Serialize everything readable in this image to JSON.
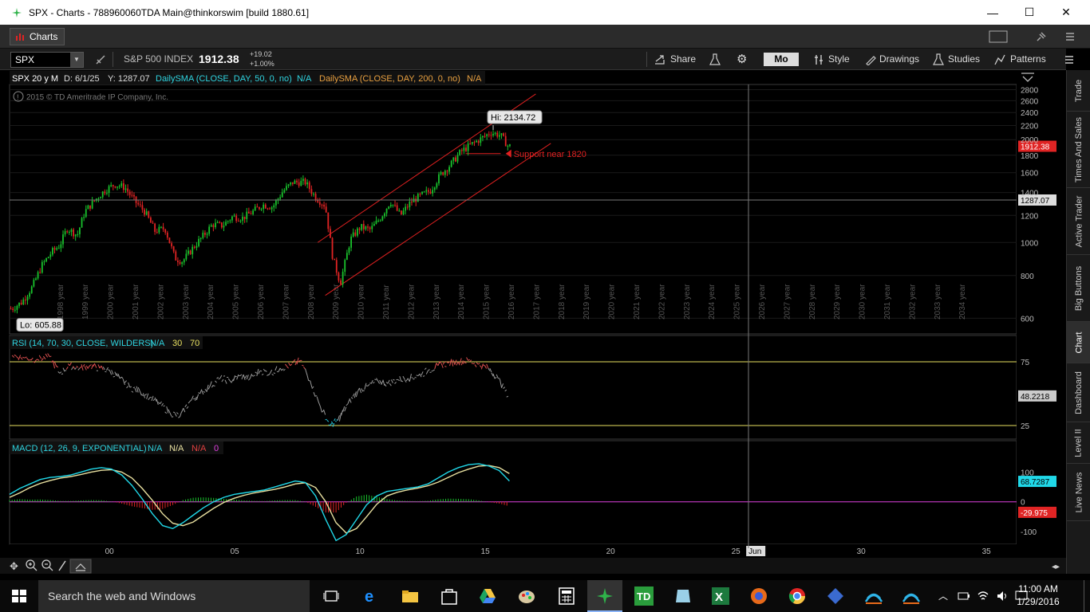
{
  "window": {
    "title": "SPX - Charts - 788960060TDA Main@thinkorswim [build 1880.61]",
    "controls": [
      "—",
      "☐",
      "✕"
    ]
  },
  "tabbar": {
    "tab_label": "Charts"
  },
  "toolbar": {
    "symbol": "SPX",
    "name": "S&P 500 INDEX",
    "price": "1912.38",
    "change": "+19.02",
    "change_pct": "+1.00%",
    "share": "Share",
    "mode": "Mo",
    "style": "Style",
    "drawings": "Drawings",
    "studies": "Studies",
    "patterns": "Patterns"
  },
  "chart_header": {
    "aggregation": "SPX 20 y M",
    "date": "D: 6/1/25",
    "y_value": "Y: 1287.07",
    "sma50": "DailySMA (CLOSE, DAY, 50, 0, no)",
    "sma50_val": "N/A",
    "sma200": "DailySMA (CLOSE, DAY, 200, 0, no)",
    "sma200_val": "N/A",
    "copyright": "2015 © TD Ameritrade IP Company, Inc."
  },
  "annotations": {
    "hi_label": "Hi: 2134.72",
    "lo_label": "Lo: 605.88",
    "support_label": "Support near 1820",
    "price_badge": "1912.38",
    "cursor_badge": "1287.07"
  },
  "rsi": {
    "header": "RSI (14, 70, 30, CLOSE, WILDERS)",
    "val": "N/A",
    "low": "30",
    "high": "70",
    "badge": "48.2218",
    "levels": [
      "75",
      "25"
    ]
  },
  "macd": {
    "header": "MACD (12, 26, 9, EXPONENTIAL)",
    "v1": "N/A",
    "v2": "N/A",
    "v3": "N/A",
    "v4": "0",
    "badge_value": "68.7287",
    "badge_diff": "-29.975",
    "levels": [
      "100",
      "0",
      "-100"
    ]
  },
  "colors": {
    "up": "#19c22c",
    "down": "#e02424",
    "channel": "#e02020",
    "rsi_line": "#9a9a9a",
    "rsi_high": "#e05050",
    "rsi_low": "#20c8e0",
    "macd_value": "#20d8e8",
    "macd_avg": "#e8e0a0",
    "zero_line": "#e040e0"
  },
  "side_tabs": [
    "Trade",
    "Times And Sales",
    "Active Trader",
    "Big Buttons",
    "Chart",
    "Dashboard",
    "Level II",
    "Live News"
  ],
  "taskbar": {
    "search": "Search the web and Windows",
    "time": "11:00 AM",
    "date": "1/29/2016"
  },
  "chart_data": [
    {
      "type": "candlestick",
      "title": "SPX 20 y M",
      "y_ticks": [
        600,
        800,
        1000,
        1200,
        1400,
        1600,
        1800,
        2000,
        2200,
        2400,
        2600,
        2800
      ],
      "y_scale": "log",
      "ylim": [
        540,
        2900
      ],
      "x_ticks": [
        "1998 year",
        "1999 year",
        "2000 year",
        "2001 year",
        "2002 year",
        "2003 year",
        "2004 year",
        "2005 year",
        "2006 year",
        "2007 year",
        "2008 year",
        "2009 year",
        "2010 year",
        "2011 year",
        "2012 year",
        "2013 year",
        "2014 year",
        "2015 year",
        "2016 year",
        "2017 year",
        "2018 year",
        "2019 year",
        "2020 year",
        "2021 year",
        "2022 year",
        "2023 year",
        "2024 year",
        "2025 year",
        "2026 year",
        "2027 year",
        "2028 year",
        "2029 year",
        "2030 year",
        "2031 year",
        "2032 year",
        "2033 year",
        "2034 year"
      ],
      "bottom_axis_ticks": [
        "00",
        "05",
        "10",
        "15",
        "20",
        "25",
        "Jun",
        "30",
        "35"
      ],
      "series": [
        {
          "name": "SPX",
          "x_years": [
            1996.1,
            1996.5,
            1996.9,
            1997.3,
            1997.7,
            1998.0,
            1998.3,
            1998.7,
            1999.0,
            1999.4,
            1999.8,
            2000.2,
            2000.6,
            2001.0,
            2001.4,
            2001.8,
            2002.2,
            2002.6,
            2002.9,
            2003.3,
            2003.7,
            2004.1,
            2004.5,
            2004.9,
            2005.3,
            2005.7,
            2006.1,
            2006.5,
            2006.9,
            2007.3,
            2007.8,
            2008.2,
            2008.6,
            2008.9,
            2009.2,
            2009.6,
            2010.0,
            2010.4,
            2010.8,
            2011.2,
            2011.6,
            2012.0,
            2012.4,
            2012.8,
            2013.2,
            2013.6,
            2014.0,
            2014.4,
            2014.8,
            2015.2,
            2015.6,
            2015.9
          ],
          "close": [
            640,
            670,
            740,
            860,
            940,
            980,
            1100,
            1050,
            1230,
            1330,
            1420,
            1480,
            1450,
            1320,
            1230,
            1080,
            1100,
            900,
            880,
            960,
            1040,
            1130,
            1120,
            1190,
            1180,
            1230,
            1290,
            1270,
            1410,
            1500,
            1500,
            1360,
            1280,
            900,
            760,
            1020,
            1110,
            1090,
            1180,
            1320,
            1200,
            1310,
            1370,
            1420,
            1580,
            1690,
            1840,
            1930,
            2010,
            2100,
            2060,
            1912
          ],
          "hi": 2134.72,
          "lo": 605.88,
          "support": 1820
        }
      ]
    },
    {
      "type": "line",
      "title": "RSI (14, 70, 30, CLOSE, WILDERS)",
      "ylim": [
        15,
        85
      ],
      "y_ticks": [
        25,
        75
      ],
      "series": [
        {
          "name": "RSI",
          "x_years": [
            1996.1,
            1996.6,
            1997.1,
            1997.6,
            1998.0,
            1998.4,
            1998.8,
            1999.2,
            1999.6,
            2000.0,
            2000.4,
            2000.8,
            2001.2,
            2001.6,
            2002.0,
            2002.4,
            2002.8,
            2003.2,
            2003.6,
            2004.0,
            2004.4,
            2004.8,
            2005.2,
            2005.6,
            2006.0,
            2006.4,
            2006.8,
            2007.2,
            2007.6,
            2008.0,
            2008.4,
            2008.8,
            2009.1,
            2009.5,
            2009.9,
            2010.3,
            2010.7,
            2011.1,
            2011.5,
            2011.9,
            2012.3,
            2012.7,
            2013.1,
            2013.5,
            2013.9,
            2014.3,
            2014.7,
            2015.1,
            2015.5,
            2015.9
          ],
          "values": [
            80,
            78,
            77,
            79,
            66,
            72,
            70,
            72,
            70,
            68,
            62,
            55,
            52,
            47,
            42,
            35,
            32,
            44,
            50,
            56,
            62,
            60,
            64,
            62,
            68,
            66,
            70,
            72,
            76,
            60,
            40,
            25,
            29,
            42,
            52,
            56,
            60,
            58,
            61,
            62,
            64,
            68,
            72,
            74,
            75,
            76,
            73,
            70,
            62,
            48
          ]
        }
      ]
    },
    {
      "type": "line",
      "title": "MACD (12, 26, 9, EXPONENTIAL)",
      "ylim": [
        -140,
        160
      ],
      "y_ticks": [
        -100,
        0,
        100
      ],
      "series": [
        {
          "name": "Value",
          "values": [
            25,
            45,
            60,
            75,
            82,
            85,
            90,
            100,
            110,
            115,
            110,
            90,
            55,
            10,
            -40,
            -80,
            -90,
            -70,
            -45,
            -20,
            0,
            15,
            25,
            30,
            35,
            40,
            50,
            60,
            70,
            65,
            20,
            -60,
            -130,
            -110,
            -60,
            -10,
            20,
            35,
            40,
            45,
            50,
            60,
            80,
            100,
            115,
            125,
            128,
            120,
            105,
            70
          ]
        },
        {
          "name": "Avg",
          "values": [
            15,
            30,
            48,
            62,
            72,
            80,
            85,
            92,
            100,
            106,
            108,
            100,
            80,
            45,
            5,
            -40,
            -72,
            -80,
            -68,
            -45,
            -22,
            -2,
            12,
            22,
            30,
            36,
            42,
            50,
            60,
            64,
            48,
            0,
            -70,
            -105,
            -90,
            -50,
            -8,
            20,
            32,
            40,
            46,
            54,
            66,
            82,
            98,
            110,
            120,
            122,
            115,
            95
          ]
        }
      ]
    }
  ]
}
